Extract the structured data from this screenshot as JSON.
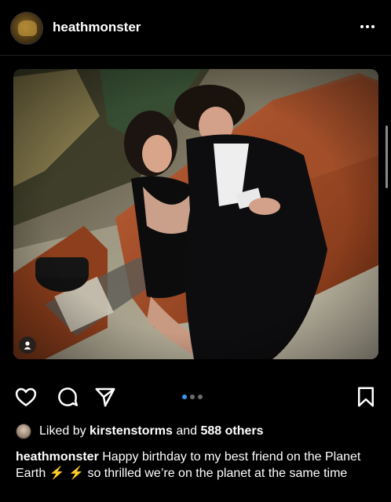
{
  "post": {
    "username": "heathmonster",
    "more_icon": "ellipsis-icon",
    "image_alt": "Couple seated on a brown leather sofa"
  },
  "actions": {
    "icons": [
      "heart-icon",
      "comment-icon",
      "share-icon",
      "bookmark-icon"
    ],
    "carousel": {
      "total": 3,
      "active": 1,
      "active_color": "#3897f0",
      "inactive_color": "#6b6b6b"
    }
  },
  "likes": {
    "prefix": "Liked by",
    "user": "kirstenstorms",
    "mid": "and",
    "others": "588 others"
  },
  "caption": {
    "username": "heathmonster",
    "text_1": "Happy birthday to my best friend on the Planet Earth",
    "bolt": "⚡",
    "text_2": "so thrilled we’re on the planet at the same time"
  },
  "colors": {
    "background": "#000000",
    "text": "#ffffff",
    "bolt": "#f4c20d"
  }
}
